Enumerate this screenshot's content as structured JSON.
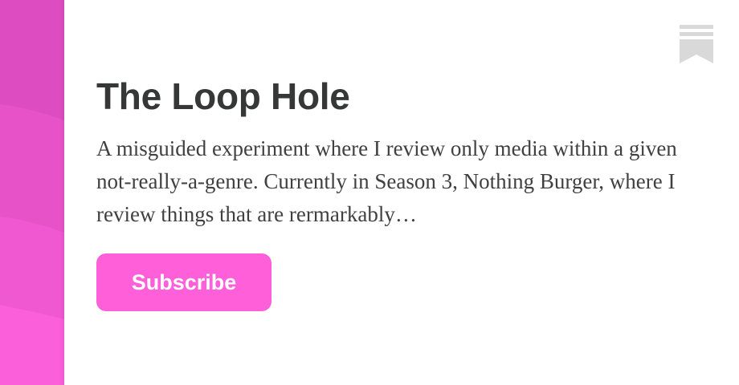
{
  "publication": {
    "title": "The Loop Hole",
    "description": "A misguided experiment where I review only media within a given not-really-a-genre. Currently in Season 3, Nothing Burger, where I review things that are rermarkably…",
    "subscribe_label": "Subscribe"
  },
  "icons": {
    "bookmark": "bookmark-icon"
  },
  "colors": {
    "accent": "#ff5fd9",
    "side_band": "#e04fc4",
    "title_text": "#363737",
    "body_text": "#404040",
    "bookmark": "#d9d9d9"
  }
}
